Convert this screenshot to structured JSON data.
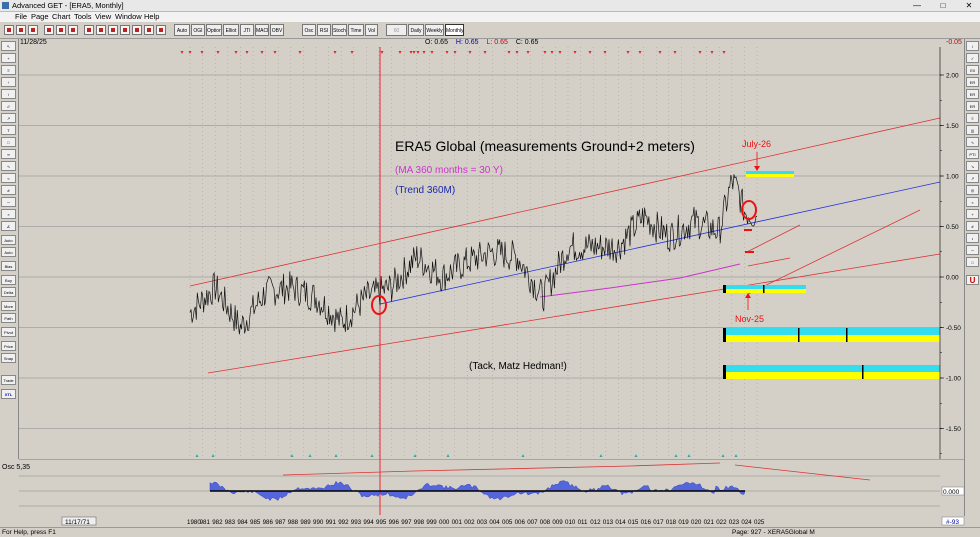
{
  "window": {
    "title": "Advanced GET - [ERA5, Monthly]"
  },
  "menu": [
    "File",
    "Page",
    "Chart",
    "Tools",
    "View",
    "Window",
    "Help"
  ],
  "toolbar": {
    "studies": [
      "Auto Gann",
      "OGI",
      "Option",
      "Elliot Trnd",
      "JTI",
      "MACD",
      "OBV",
      "Osc",
      "RSI",
      "Stoch",
      "Time Cycle",
      "Vol"
    ],
    "periods": [
      "60 Minute",
      "Daily",
      "Weekly",
      "Monthly"
    ]
  },
  "header": {
    "date": "11/28/25",
    "open": "O: 0.65",
    "high": "H: 0.65",
    "low": "L: 0.65",
    "close": "C: 0.65",
    "change": "-0.05"
  },
  "leftbar": {
    "labels": [
      "Auto Gann",
      "Auto Sell",
      "Bias",
      "Buy Sell",
      "Delta",
      "More Arcs",
      "Path Line",
      "Pivot",
      "Price Chan",
      "Snap Stops",
      "Trade Profile",
      "XTL"
    ]
  },
  "rightbar": {
    "labels": [
      "Ell",
      "ER SET",
      "ER SET",
      "ER TPE",
      "PTI"
    ]
  },
  "chart_data": {
    "type": "line",
    "title": "ERA5 Global (measurements Ground+2 meters)",
    "annotations": [
      "(MA 360 months = 30 Y)",
      "(Trend 360M)",
      "(Tack, Matz Hedman!)",
      "July-26",
      "Nov-25"
    ],
    "y_ticks": [
      "2.00",
      "1.50",
      "1.00",
      "0.50",
      "0.00",
      "-0.50",
      "-1.00",
      "-1.50"
    ],
    "ylim": [
      -1.75,
      2.2
    ],
    "x_labels": [
      "1980",
      "981",
      "982",
      "983",
      "984",
      "985",
      "986",
      "987",
      "988",
      "989",
      "990",
      "991",
      "992",
      "993",
      "994",
      "995",
      "996",
      "997",
      "998",
      "999",
      "000",
      "001",
      "002",
      "003",
      "004",
      "005",
      "006",
      "007",
      "008",
      "009",
      "010",
      "011",
      "012",
      "013",
      "014",
      "015",
      "016",
      "017",
      "018",
      "019",
      "020",
      "021",
      "022",
      "023",
      "024",
      "025"
    ],
    "series": [
      {
        "x": [
          1980,
          1982,
          1984,
          1986,
          1988,
          1990,
          1992,
          1994,
          1996,
          1998,
          2000,
          2002,
          2004,
          2006,
          2008,
          2010,
          2012,
          2014,
          2016,
          2018,
          2020,
          2022,
          2023,
          2023.5,
          2024,
          2025
        ],
        "values": [
          -0.35,
          -0.1,
          -0.5,
          -0.15,
          -0.1,
          -0.2,
          -0.45,
          -0.2,
          -0.1,
          0.2,
          0.0,
          0.15,
          0.25,
          0.2,
          -0.2,
          0.3,
          0.3,
          0.3,
          0.6,
          0.4,
          0.55,
          0.45,
          0.95,
          0.85,
          0.65,
          0.6
        ]
      }
    ],
    "oscillator": {
      "label": "Osc 5,35",
      "value": "0.000"
    }
  },
  "status": {
    "left": "For Help, press F1",
    "right": "Page: 927 - XERA5Global M",
    "date_corner": "11/17/71",
    "bar_count": "#-93"
  }
}
